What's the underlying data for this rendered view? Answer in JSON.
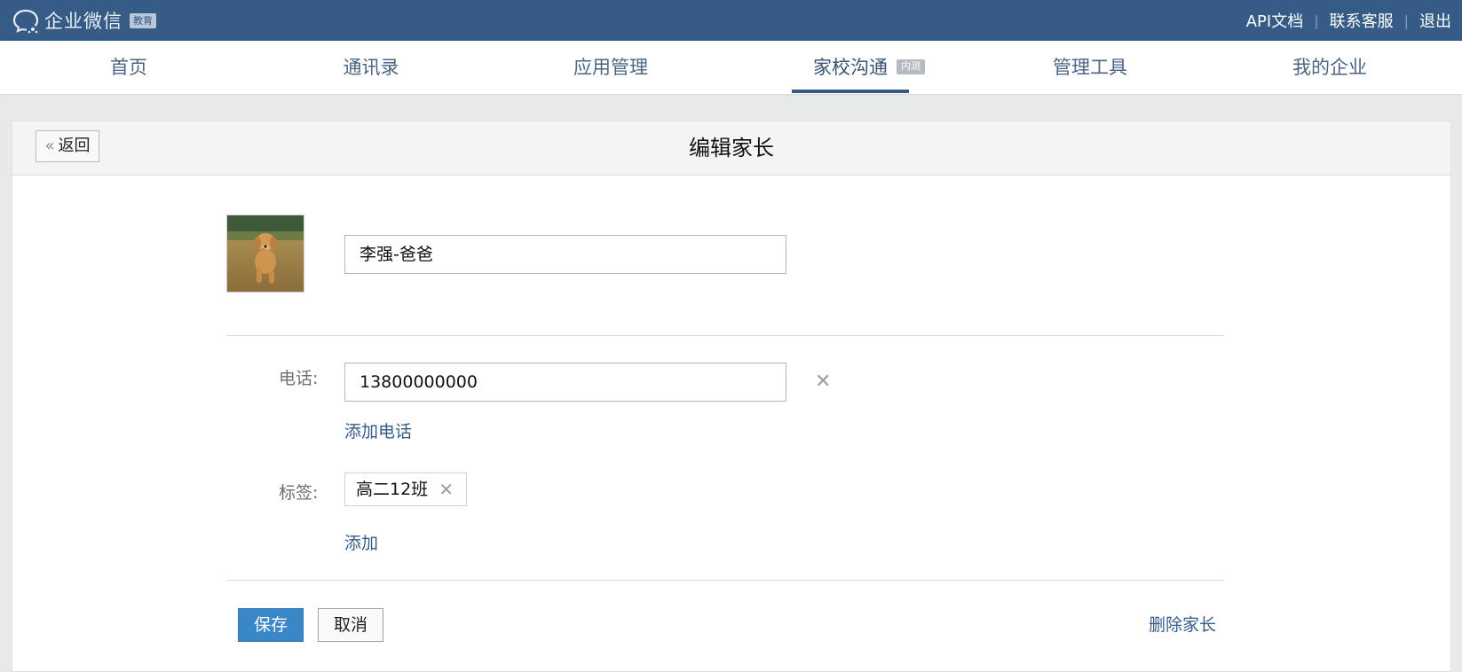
{
  "header": {
    "logo_text": "企业微信",
    "logo_badge": "教育",
    "links": [
      "API文档",
      "联系客服",
      "退出"
    ]
  },
  "nav": {
    "items": [
      "首页",
      "通讯录",
      "应用管理",
      "家校沟通",
      "管理工具",
      "我的企业"
    ],
    "active": "家校沟通",
    "active_badge": "内测"
  },
  "page": {
    "back_label": "返回",
    "title": "编辑家长"
  },
  "form": {
    "name_value": "李强-爸爸",
    "phone_label": "电话:",
    "phone_value": "13800000000",
    "add_phone_label": "添加电话",
    "tag_label": "标签:",
    "tags": [
      "高二12班"
    ],
    "add_tag_label": "添加"
  },
  "actions": {
    "save_label": "保存",
    "cancel_label": "取消",
    "delete_label": "删除家长"
  },
  "colors": {
    "topbar": "#345c87",
    "primary_button": "#3a87c8",
    "link": "#345c87"
  },
  "icons": [
    "chat-bubble-logo-icon",
    "double-chevron-left-icon",
    "clear-x-icon",
    "tag-remove-x-icon"
  ]
}
